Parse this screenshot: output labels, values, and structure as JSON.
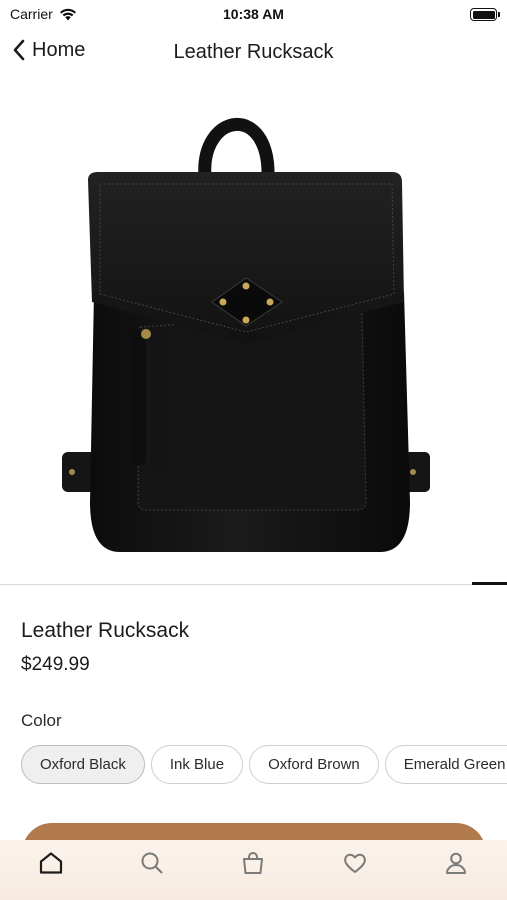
{
  "status_bar": {
    "carrier": "Carrier",
    "time": "10:38 AM",
    "icons": [
      "wifi-icon",
      "battery-icon"
    ]
  },
  "nav": {
    "back_label": "Home",
    "title": "Leather Rucksack",
    "back_icon": "chevron-left-icon"
  },
  "product": {
    "name": "Leather Rucksack",
    "price": "$249.99",
    "color_label": "Color",
    "colors": [
      {
        "label": "Oxford Black",
        "selected": true
      },
      {
        "label": "Ink Blue",
        "selected": false
      },
      {
        "label": "Oxford Brown",
        "selected": false
      },
      {
        "label": "Emerald Green",
        "selected": false
      }
    ]
  },
  "tabs": [
    {
      "icon": "home-icon",
      "active": true
    },
    {
      "icon": "search-icon",
      "active": false
    },
    {
      "icon": "shopping-bag-icon",
      "active": false
    },
    {
      "icon": "heart-icon",
      "active": false
    },
    {
      "icon": "profile-icon",
      "active": false
    }
  ],
  "colors": {
    "accent": "#b07a4c",
    "tab_bar_bg": "#f8eee4",
    "active_icon": "#1c1c1e",
    "inactive_icon": "#7a7a7a"
  }
}
